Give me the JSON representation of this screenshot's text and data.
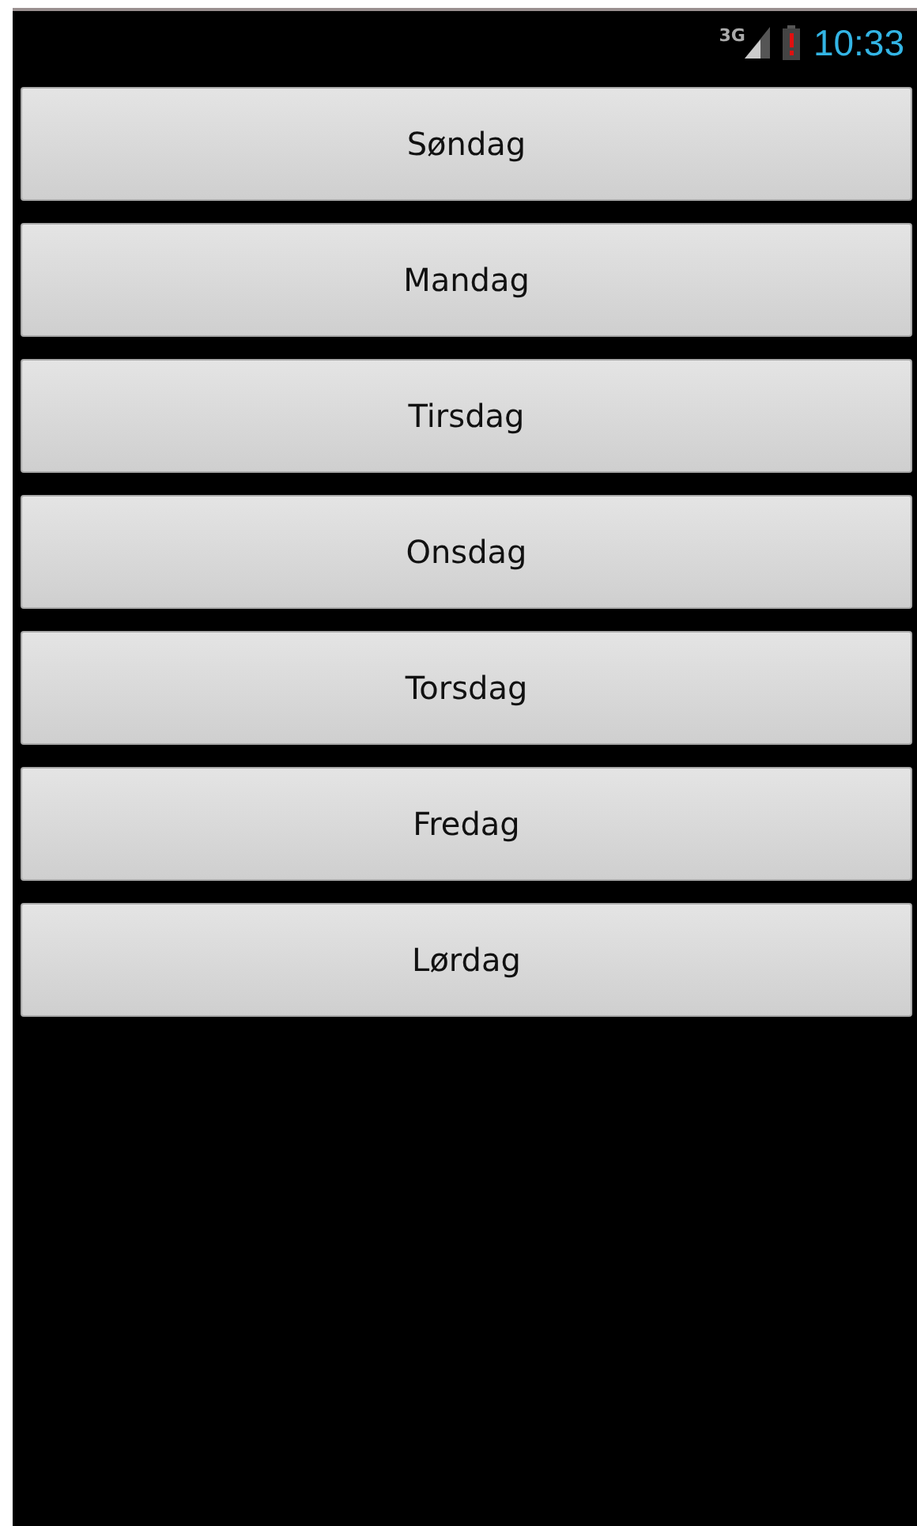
{
  "status_bar": {
    "network": "3G",
    "time": "10:33"
  },
  "buttons": [
    {
      "label": "Søndag"
    },
    {
      "label": "Mandag"
    },
    {
      "label": "Tirsdag"
    },
    {
      "label": "Onsdag"
    },
    {
      "label": "Torsdag"
    },
    {
      "label": "Fredag"
    },
    {
      "label": "Lørdag"
    }
  ]
}
